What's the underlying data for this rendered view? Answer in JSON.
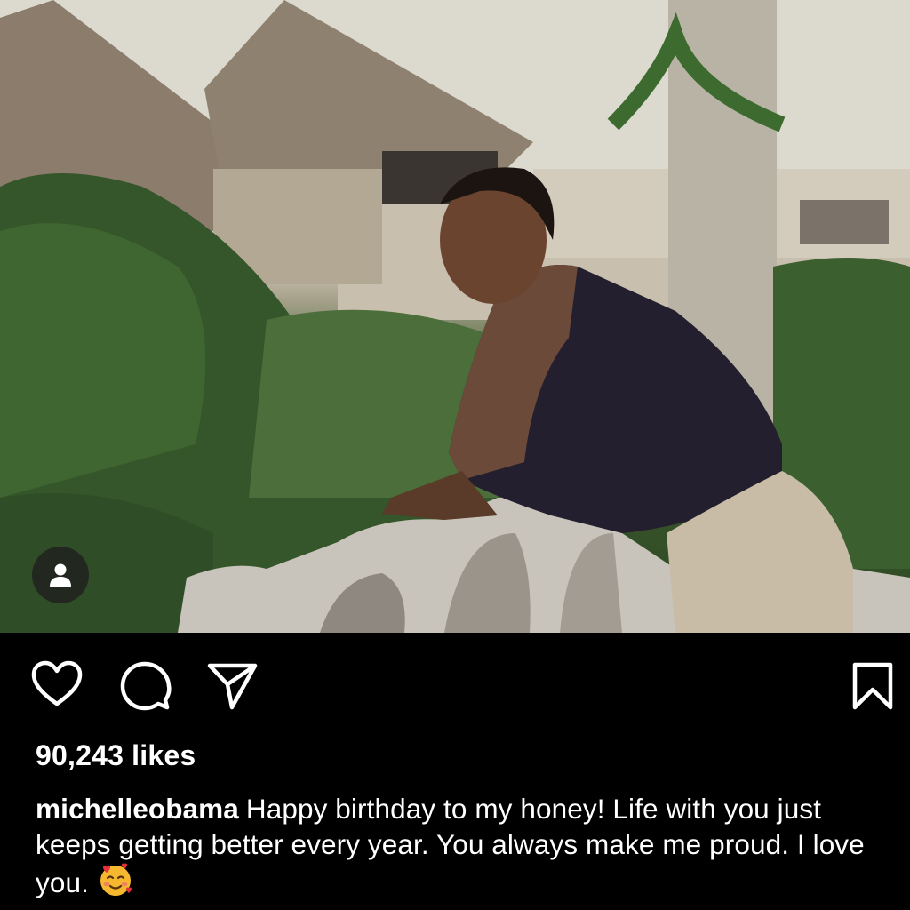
{
  "post": {
    "media": {
      "alt_icon": "person-tag-icon"
    },
    "actions": {
      "like_icon": "heart-icon",
      "comment_icon": "comment-icon",
      "share_icon": "send-icon",
      "save_icon": "bookmark-icon"
    },
    "likes_text": "90,243 likes",
    "caption": {
      "username": "michelleobama",
      "text": "Happy birthday to my honey! Life with you just keeps getting better every year. You always make me proud. I love you.",
      "emoji": "smiling-face-with-hearts"
    }
  },
  "colors": {
    "background": "#000000",
    "text": "#ffffff"
  }
}
